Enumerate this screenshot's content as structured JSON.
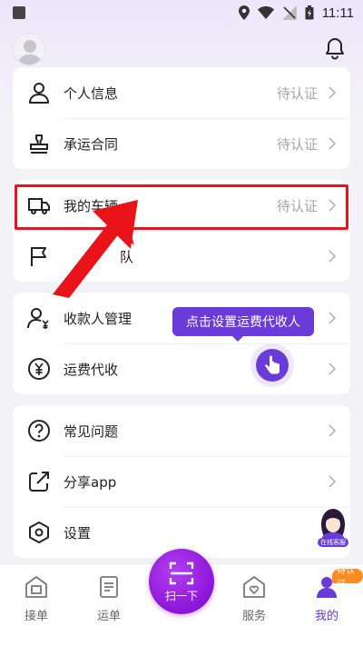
{
  "status_bar": {
    "time": "11:11"
  },
  "card1": {
    "rows": [
      {
        "label": "个人信息",
        "status": "待认证"
      },
      {
        "label": "承运合同",
        "status": "待认证"
      }
    ]
  },
  "card2": {
    "rows": [
      {
        "label": "我的车辆",
        "status": "待认证"
      },
      {
        "label": "队"
      }
    ]
  },
  "card3": {
    "rows": [
      {
        "label": "收款人管理"
      },
      {
        "label": "运费代收"
      }
    ]
  },
  "card4": {
    "rows": [
      {
        "label": "常见问题"
      },
      {
        "label": "分享app"
      },
      {
        "label": "设置"
      }
    ]
  },
  "tooltip": {
    "text": "点击设置运费代收人"
  },
  "agent": {
    "label": "在线客服"
  },
  "bottom_nav": {
    "items": [
      {
        "label": "接单",
        "icon": "order-receive-icon"
      },
      {
        "label": "运单",
        "icon": "waybill-icon"
      },
      {
        "label": "服务",
        "icon": "service-icon"
      },
      {
        "label": "我的",
        "icon": "profile-icon"
      }
    ],
    "scan_label": "扫一下",
    "badge": "待认证"
  },
  "colors": {
    "accent": "#6a3bd9",
    "highlight": "#e8141a",
    "scan": "#8b16d8",
    "badge": "#ff8a1e"
  }
}
